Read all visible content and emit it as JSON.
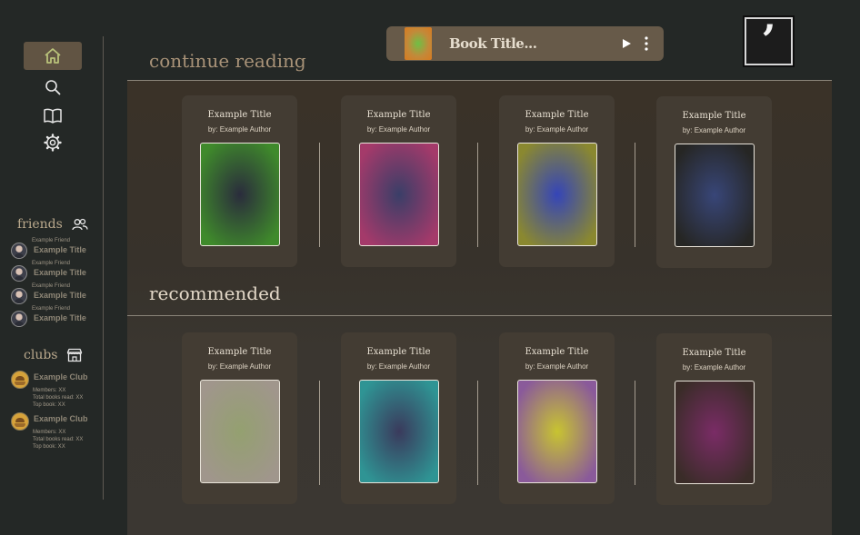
{
  "colors": {
    "background": "#242826",
    "sidebar_active": "#615443",
    "accent_text": "#b9a88c",
    "player_bg": "#675a49"
  },
  "nav": {
    "items": [
      {
        "name": "home",
        "icon": "home-icon",
        "active": true
      },
      {
        "name": "search",
        "icon": "search-icon",
        "active": false
      },
      {
        "name": "library",
        "icon": "open-book-icon",
        "active": false
      },
      {
        "name": "settings",
        "icon": "gear-icon",
        "active": false
      }
    ]
  },
  "friends": {
    "label": "friends",
    "icon": "people-icon",
    "items": [
      {
        "name": "Example Friend",
        "title": "Example Title"
      },
      {
        "name": "Example Friend",
        "title": "Example Title"
      },
      {
        "name": "Example Friend",
        "title": "Example Title"
      },
      {
        "name": "Example Friend",
        "title": "Example Title"
      }
    ]
  },
  "clubs": {
    "label": "clubs",
    "icon": "storefront-icon",
    "items": [
      {
        "name": "Example Club",
        "members": "Members: XX",
        "total_read": "Total books read: XX",
        "top_book": "Top book: XX"
      },
      {
        "name": "Example Club",
        "members": "Members: XX",
        "total_read": "Total books read: XX",
        "top_book": "Top book: XX"
      }
    ]
  },
  "player": {
    "title": "Book Title...",
    "play_icon": "play-icon",
    "more_icon": "more-vertical-icon"
  },
  "logo": {
    "glyph": "’"
  },
  "continue_reading": {
    "title": "continue reading",
    "books": [
      {
        "title": "Example Title",
        "author": "by: Example Author",
        "cover_colors": [
          "#2a2c3c",
          "#3f8a2b"
        ]
      },
      {
        "title": "Example Title",
        "author": "by: Example Author",
        "cover_colors": [
          "#3a3e68",
          "#a43a6a"
        ]
      },
      {
        "title": "Example Title",
        "author": "by: Example Author",
        "cover_colors": [
          "#3545b8",
          "#8a8830"
        ]
      },
      {
        "title": "Example Title",
        "author": "by: Example Author",
        "cover_colors": [
          "#384678",
          "#262624"
        ]
      }
    ]
  },
  "recommended": {
    "title": "recommended",
    "books": [
      {
        "title": "Example Title",
        "author": "by: Example Author",
        "cover_colors": [
          "#94a070",
          "#a0968c"
        ]
      },
      {
        "title": "Example Title",
        "author": "by: Example Author",
        "cover_colors": [
          "#3a3a5c",
          "#2f9494"
        ]
      },
      {
        "title": "Example Title",
        "author": "by: Example Author",
        "cover_colors": [
          "#c8c430",
          "#8a5a9a"
        ]
      },
      {
        "title": "Example Title",
        "author": "by: Example Author",
        "cover_colors": [
          "#7a2c66",
          "#3a2c28"
        ]
      }
    ]
  }
}
